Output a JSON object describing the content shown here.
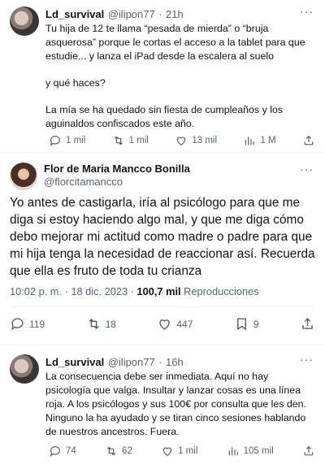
{
  "tweet1": {
    "name": "Ld_survival",
    "handle": "@ilipon77",
    "time": "21h",
    "paragraphs": [
      "Tu hija de 12 te llama “pesada de mierda” o “bruja asquerosa” porque le cortas el acceso a la tablet para que estudie... y lanza el iPad desde la escalera al suelo",
      "y qué haces?",
      "La mía se ha quedado sin fiesta de cumpleaños y los aguinaldos confiscados este año."
    ],
    "replies": "1 mil",
    "retweets": "1 mil",
    "likes": "13 mil",
    "views": "1 M"
  },
  "main": {
    "name": "Flor de Maria Mancco Bonilla",
    "handle": "@florcitamancco",
    "text": "Yo antes de castigarla, iría al psicólogo para que me diga si estoy haciendo algo mal, y que me diga cómo debo mejorar mi actitud como madre o padre para que mi hija tenga la necesidad de reaccionar así. Recuerda que ella es fruto de toda tu crianza",
    "timestamp": "10:02 p. m. · 18 dic. 2023 ·",
    "views": "100,7 mil",
    "views_label": "Reproducciones",
    "replies": "119",
    "retweets": "18",
    "likes": "447",
    "bookmarks": "9"
  },
  "tweet3": {
    "name": "Ld_survival",
    "handle": "@ilipon77",
    "time": "16h",
    "text": "La consecuencia debe ser inmediata. Aquí no hay psicología que valga. Insultar y lanzar cosas es una línea roja. A los psicólogos y sus 100€ por consulta que les den. Ninguno la ha ayudado y se tiran cinco sesiones hablando de nuestros ancestros. Fuera.",
    "replies": "74",
    "retweets": "62",
    "likes": "1 mil",
    "views": "105 mil"
  },
  "icons": [
    "reply-icon",
    "retweet-icon",
    "like-icon",
    "views-icon",
    "bookmark-icon",
    "share-icon",
    "more-icon"
  ]
}
